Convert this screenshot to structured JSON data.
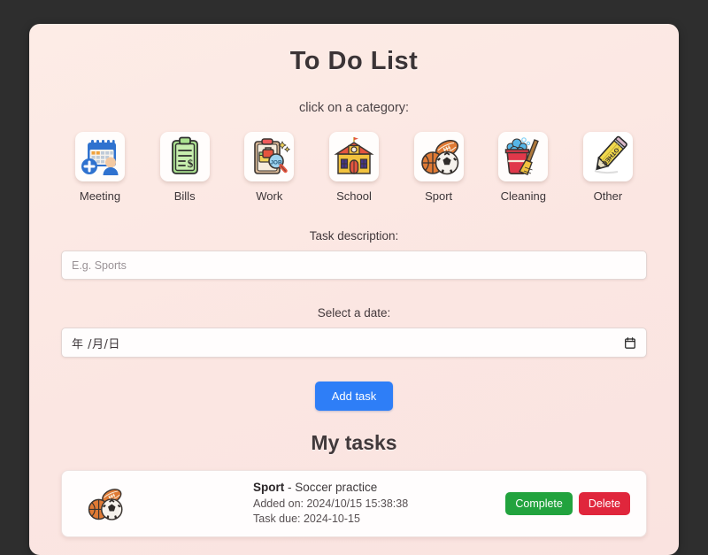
{
  "app": {
    "title": "To Do List",
    "subtitle": "click on a category:",
    "tasks_heading": "My tasks"
  },
  "categories": [
    {
      "label": "Meeting",
      "icon": "calendar-person-icon"
    },
    {
      "label": "Bills",
      "icon": "clipboard-dollar-icon"
    },
    {
      "label": "Work",
      "icon": "clipboard-briefcase-magnifier-icon"
    },
    {
      "label": "School",
      "icon": "school-building-icon"
    },
    {
      "label": "Sport",
      "icon": "sports-balls-icon"
    },
    {
      "label": "Cleaning",
      "icon": "bucket-broom-icon"
    },
    {
      "label": "Other",
      "icon": "pencil-icon"
    }
  ],
  "form": {
    "description_label": "Task description:",
    "description_value": "",
    "description_placeholder": "E.g. Sports",
    "date_label": "Select a date:",
    "date_placeholder": "年 /月/日",
    "date_value": "",
    "add_button": "Add task"
  },
  "tasks": [
    {
      "category": "Sport",
      "separator": " - ",
      "description": "Soccer practice",
      "added_on": "Added on: 2024/10/15 15:38:38",
      "due": "Task due: 2024-10-15",
      "complete_label": "Complete",
      "delete_label": "Delete",
      "icon": "sports-balls-icon"
    }
  ],
  "colors": {
    "page_background": "#2e2e2e",
    "card_background": "#fbe6e2",
    "accent_blue": "#2e7ef7",
    "complete_green": "#22a33e",
    "delete_red": "#e0263c",
    "title_text": "#3b3436"
  }
}
